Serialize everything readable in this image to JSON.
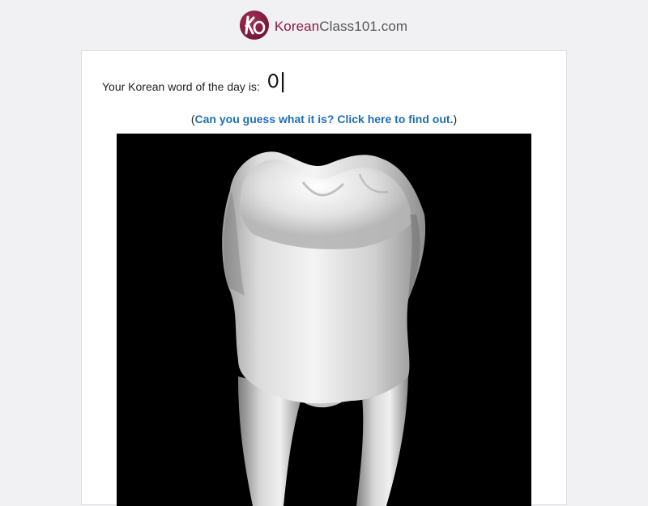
{
  "header": {
    "logo": {
      "brand": "Korean",
      "rest": "Class101.com",
      "monogram": "KO",
      "brand_color": "#8c1d3e"
    }
  },
  "word_of_day": {
    "label": "Your Korean word of the day is:",
    "word": "이"
  },
  "guess_prompt": {
    "open": "(",
    "link_text": "Can you guess what it is? Click here to find out.",
    "close": ")",
    "link_color": "#1f6fb5"
  },
  "image": {
    "subject": "tooth-image",
    "background": "#000000"
  }
}
